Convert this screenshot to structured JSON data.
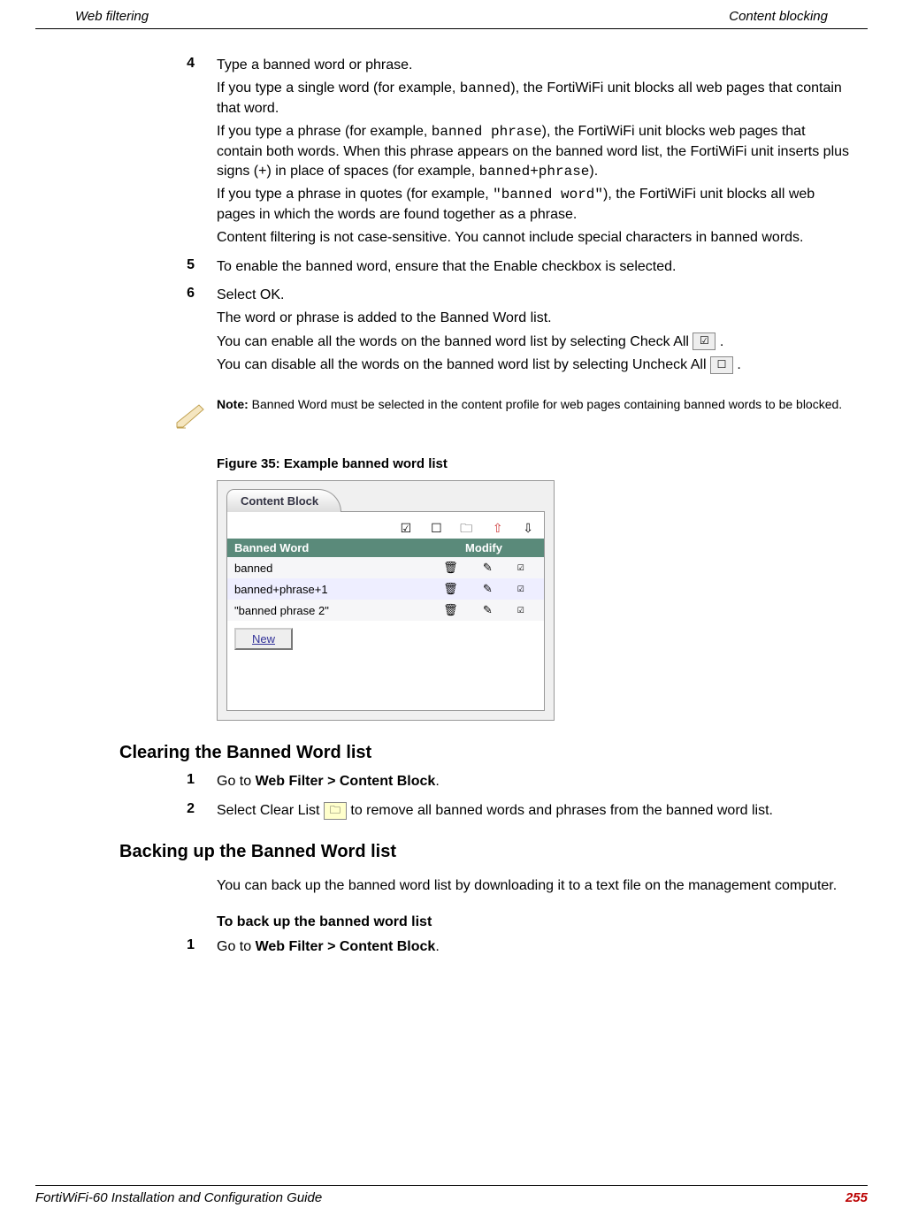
{
  "header": {
    "left": "Web filtering",
    "right": "Content blocking"
  },
  "steps": {
    "s4": {
      "num": "4",
      "p1a": "Type a banned word or phrase.",
      "p2a": "If you type a single word (for example, ",
      "p2code": "banned",
      "p2b": "), the FortiWiFi unit blocks all web pages that contain that word.",
      "p3a": "If you type a phrase (for example, ",
      "p3code": "banned phrase",
      "p3b": "), the FortiWiFi unit blocks web pages that contain both words. When this phrase appears on the banned word list, the FortiWiFi unit inserts plus signs (+) in place of spaces (for example, ",
      "p3code2": "banned+phrase",
      "p3c": ").",
      "p4a": "If you type a phrase in quotes (for example, ",
      "p4code": "\"banned word\"",
      "p4b": "), the FortiWiFi unit blocks all web pages in which the words are found together as a phrase.",
      "p5": "Content filtering is not case-sensitive. You cannot include special characters in banned words."
    },
    "s5": {
      "num": "5",
      "p1": "To enable the banned word, ensure that the Enable checkbox is selected."
    },
    "s6": {
      "num": "6",
      "p1": "Select OK.",
      "p2": "The word or phrase is added to the Banned Word list.",
      "p3a": "You can enable all the words on the banned word list by selecting Check All ",
      "p3b": " .",
      "p4a": "You can disable all the words on the banned word list by selecting Uncheck All ",
      "p4b": " ."
    }
  },
  "note": {
    "label": "Note:",
    "text": " Banned Word must be selected in the content profile for web pages containing banned words to be blocked."
  },
  "figure": {
    "caption": "Figure 35: Example banned word list",
    "tab": "Content Block",
    "header_col1": "Banned Word",
    "header_col2": "Modify",
    "rows": [
      {
        "word": "banned"
      },
      {
        "word": "banned+phrase+1"
      },
      {
        "word": "\"banned phrase 2\""
      }
    ],
    "new_btn": "New"
  },
  "section_clearing": {
    "title": "Clearing the Banned Word list",
    "s1num": "1",
    "s1a": "Go to ",
    "s1b": "Web Filter > Content Block",
    "s1c": ".",
    "s2num": "2",
    "s2a": "Select Clear List ",
    "s2b": " to remove all banned words and phrases from the banned word list."
  },
  "section_backup": {
    "title": "Backing up the Banned Word list",
    "intro": "You can back up the banned word list by downloading it to a text file on the management computer.",
    "subhead": "To back up the banned word list",
    "s1num": "1",
    "s1a": "Go to ",
    "s1b": "Web Filter > Content Block",
    "s1c": "."
  },
  "footer": {
    "left": "FortiWiFi-60 Installation and Configuration Guide",
    "page": "255"
  }
}
